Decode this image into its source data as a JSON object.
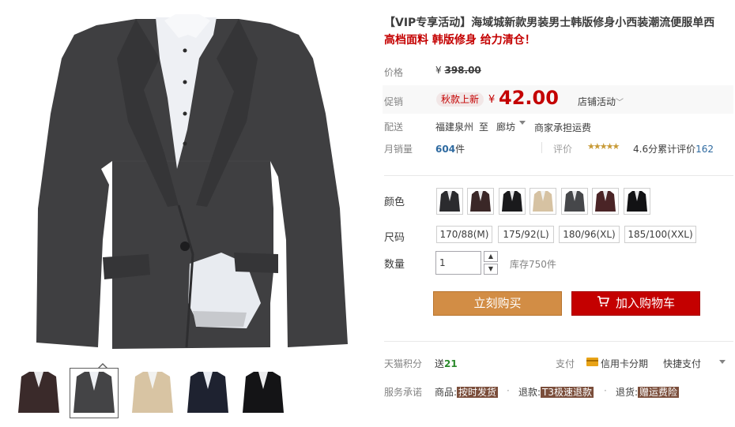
{
  "product": {
    "title": "【VIP专享活动】海域城新款男装男士韩版修身小西装潮流便服单西",
    "subtitle": "高档面料 韩版修身 给力清仓！"
  },
  "price": {
    "label": "价格",
    "currency": "¥",
    "original": "398.00"
  },
  "promo": {
    "label": "促销",
    "badge": "秋款上新",
    "currency": "¥",
    "price": "42.00",
    "activity": "店铺活动"
  },
  "shipping": {
    "label": "配送",
    "from": "福建泉州",
    "to_label": "至",
    "to": "廊坊",
    "fee": "商家承担运费"
  },
  "sales": {
    "label": "月销量",
    "count": "604",
    "unit": "件",
    "rating_label": "评价",
    "stars": "★★★★★",
    "score": "4.6分",
    "review_label": "累计评价",
    "review_count": "162"
  },
  "options": {
    "color_label": "颜色",
    "size_label": "尺码",
    "sizes": [
      "170/88(M)",
      "175/92(L)",
      "180/96(XL)",
      "185/100(XXL)"
    ],
    "qty_label": "数量",
    "qty_value": "1",
    "stock": "库存750件"
  },
  "actions": {
    "buy_now": "立刻购买",
    "add_to_cart": "加入购物车"
  },
  "points": {
    "label": "天猫积分",
    "send": "送",
    "value": "21"
  },
  "payment": {
    "label": "支付",
    "card": "信用卡分期",
    "fast": "快捷支付"
  },
  "service": {
    "label": "服务承诺",
    "goods": "商品:",
    "goods_tag": "按时发货",
    "refund": "退款:",
    "refund_tag": "T3极速退款",
    "return": "退货:",
    "return_tag": "赠运费险"
  },
  "colors": {
    "price_red": "#c40000",
    "buy_orange": "#d28d45",
    "jacket_dark": "#3d3d3d"
  }
}
